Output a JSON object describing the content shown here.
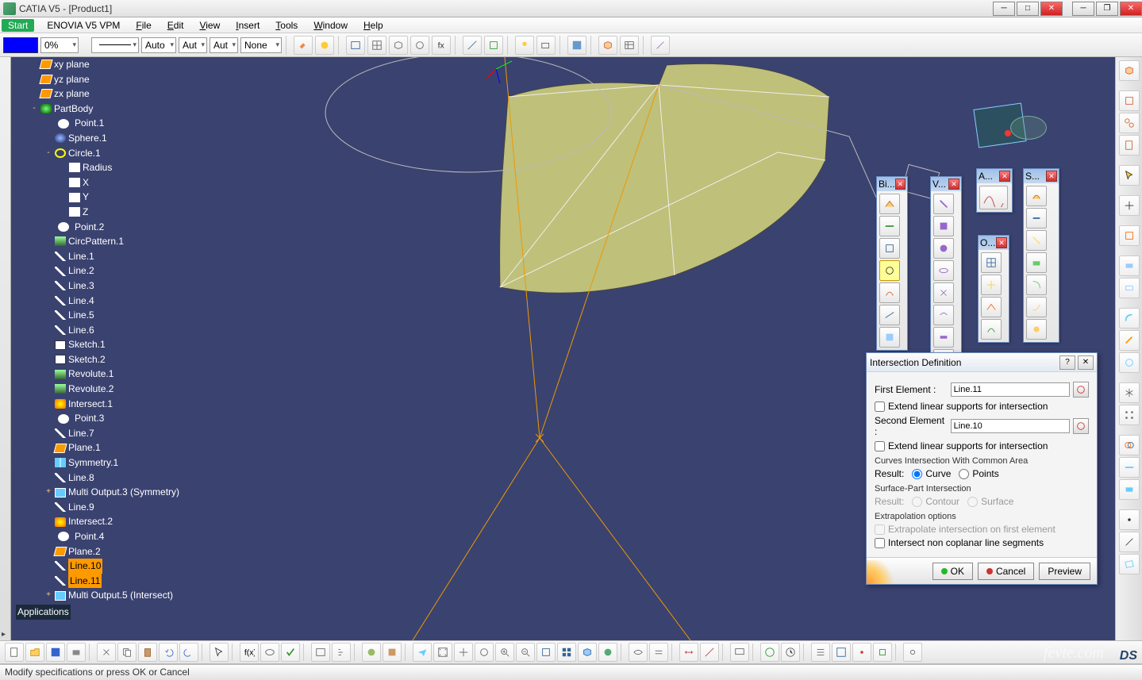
{
  "title": "CATIA V5 - [Product1]",
  "menus": {
    "start": "Start",
    "enovia": "ENOVIA V5 VPM",
    "file": "File",
    "edit": "Edit",
    "view": "View",
    "insert": "Insert",
    "tools": "Tools",
    "window": "Window",
    "help": "Help"
  },
  "proprow": {
    "opacity": "0%",
    "auto1": "Auto",
    "auto2": "Aut",
    "auto3": "Aut",
    "none": "None"
  },
  "tree": [
    {
      "l": 1,
      "ic": "ic-plane",
      "t": "xy plane"
    },
    {
      "l": 1,
      "ic": "ic-plane",
      "t": "yz plane"
    },
    {
      "l": 1,
      "ic": "ic-plane",
      "t": "zx plane"
    },
    {
      "l": 1,
      "ic": "ic-body",
      "t": "PartBody",
      "tg": "-"
    },
    {
      "l": 2,
      "ic": "ic-point",
      "t": "Point.1"
    },
    {
      "l": 2,
      "ic": "ic-sphere",
      "t": "Sphere.1"
    },
    {
      "l": 2,
      "ic": "ic-circle",
      "t": "Circle.1",
      "tg": "-"
    },
    {
      "l": 3,
      "ic": "ic-fx",
      "t": "Radius"
    },
    {
      "l": 3,
      "ic": "ic-fx",
      "t": "X"
    },
    {
      "l": 3,
      "ic": "ic-fx",
      "t": "Y"
    },
    {
      "l": 3,
      "ic": "ic-fx",
      "t": "Z"
    },
    {
      "l": 2,
      "ic": "ic-point",
      "t": "Point.2"
    },
    {
      "l": 2,
      "ic": "ic-rev",
      "t": "CircPattern.1"
    },
    {
      "l": 2,
      "ic": "ic-line",
      "t": "Line.1"
    },
    {
      "l": 2,
      "ic": "ic-line",
      "t": "Line.2"
    },
    {
      "l": 2,
      "ic": "ic-line",
      "t": "Line.3"
    },
    {
      "l": 2,
      "ic": "ic-line",
      "t": "Line.4"
    },
    {
      "l": 2,
      "ic": "ic-line",
      "t": "Line.5"
    },
    {
      "l": 2,
      "ic": "ic-line",
      "t": "Line.6"
    },
    {
      "l": 2,
      "ic": "ic-sketch",
      "t": "Sketch.1"
    },
    {
      "l": 2,
      "ic": "ic-sketch",
      "t": "Sketch.2"
    },
    {
      "l": 2,
      "ic": "ic-rev",
      "t": "Revolute.1"
    },
    {
      "l": 2,
      "ic": "ic-rev",
      "t": "Revolute.2"
    },
    {
      "l": 2,
      "ic": "ic-int",
      "t": "Intersect.1"
    },
    {
      "l": 2,
      "ic": "ic-point",
      "t": "Point.3"
    },
    {
      "l": 2,
      "ic": "ic-line",
      "t": "Line.7",
      "sel": false
    },
    {
      "l": 2,
      "ic": "ic-plane",
      "t": "Plane.1"
    },
    {
      "l": 2,
      "ic": "ic-sym",
      "t": "Symmetry.1"
    },
    {
      "l": 2,
      "ic": "ic-line",
      "t": "Line.8"
    },
    {
      "l": 2,
      "ic": "ic-multi",
      "t": "Multi Output.3 (Symmetry)",
      "tg": "+"
    },
    {
      "l": 2,
      "ic": "ic-line",
      "t": "Line.9"
    },
    {
      "l": 2,
      "ic": "ic-int",
      "t": "Intersect.2"
    },
    {
      "l": 2,
      "ic": "ic-point",
      "t": "Point.4"
    },
    {
      "l": 2,
      "ic": "ic-plane",
      "t": "Plane.2"
    },
    {
      "l": 2,
      "ic": "ic-line",
      "t": "Line.10",
      "sel": true
    },
    {
      "l": 2,
      "ic": "ic-line",
      "t": "Line.11",
      "sel": true
    },
    {
      "l": 2,
      "ic": "ic-multi",
      "t": "Multi Output.5 (Intersect)",
      "tg": "+"
    }
  ],
  "tree_apps": "Applications",
  "palettes": {
    "bi": "Bi...",
    "v": "V...",
    "a": "A...",
    "s": "S...",
    "o": "O..."
  },
  "dialog": {
    "title": "Intersection Definition",
    "first_label": "First Element :",
    "first_value": "Line.11",
    "extend1": "Extend linear supports for intersection",
    "second_label": "Second Element :",
    "second_value": "Line.10",
    "extend2": "Extend linear supports for intersection",
    "curves_hdr": "Curves Intersection With Common Area",
    "result": "Result:",
    "curve": "Curve",
    "points": "Points",
    "surf_hdr": "Surface-Part Intersection",
    "contour": "Contour",
    "surface": "Surface",
    "extra_hdr": "Extrapolation options",
    "extra_chk": "Extrapolate intersection on first element",
    "noncop": "Intersect non coplanar line segments",
    "ok": "OK",
    "cancel": "Cancel",
    "preview": "Preview"
  },
  "status": "Modify specifications or press OK or Cancel",
  "watermark": "fevte.com"
}
